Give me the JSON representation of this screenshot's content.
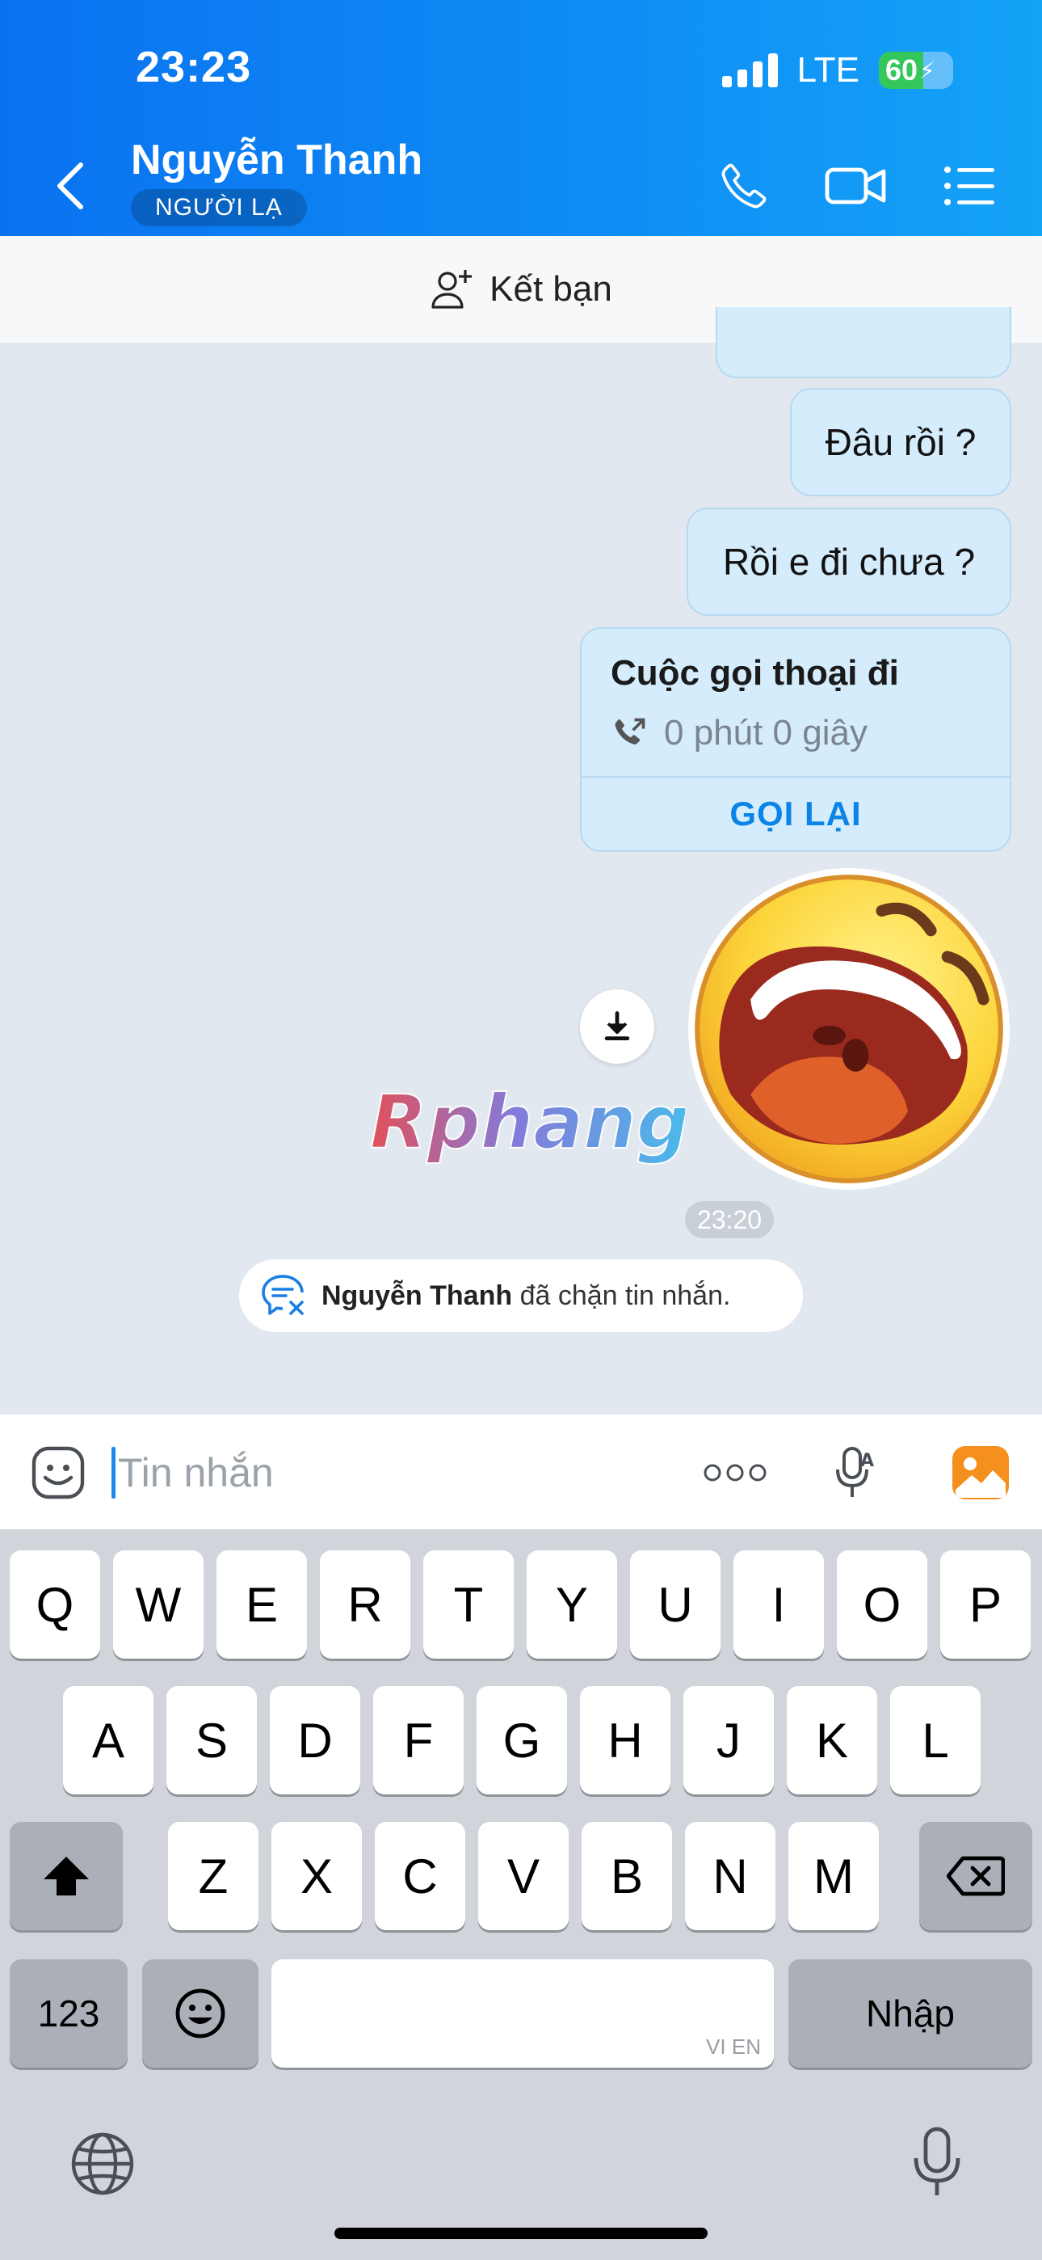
{
  "status_bar": {
    "time": "23:23",
    "network": "LTE",
    "battery": "60"
  },
  "header": {
    "contact_name": "Nguyễn Thanh",
    "contact_badge": "NGƯỜI LẠ"
  },
  "add_friend": {
    "label": "Kết bạn"
  },
  "messages": [
    {
      "type": "text",
      "from": "me",
      "text": "Đâu rồi ?"
    },
    {
      "type": "text",
      "from": "me",
      "text": "Rồi e đi chưa ?"
    }
  ],
  "call_card": {
    "title": "Cuộc gọi thoại đi",
    "duration": "0 phút 0 giây",
    "action": "GỌI LẠI"
  },
  "watermark": "Rphang",
  "sticker": {
    "icon": "laughing-emoji-sticker"
  },
  "timestamp": "23:20",
  "block_notice": {
    "name": "Nguyễn Thanh",
    "text": "đã chặn tin nhắn."
  },
  "composer": {
    "placeholder": "Tin nhắn"
  },
  "keyboard": {
    "row1": [
      "Q",
      "W",
      "E",
      "R",
      "T",
      "Y",
      "U",
      "I",
      "O",
      "P"
    ],
    "row2": [
      "A",
      "S",
      "D",
      "F",
      "G",
      "H",
      "J",
      "K",
      "L"
    ],
    "row3": [
      "Z",
      "X",
      "C",
      "V",
      "B",
      "N",
      "M"
    ],
    "numbers_key": "123",
    "return_key": "Nhập",
    "space_hint": "VI EN"
  },
  "colors": {
    "header_blue": "#0a72f0",
    "bubble_blue": "#d5ecfc",
    "accent": "#0a84e6"
  }
}
